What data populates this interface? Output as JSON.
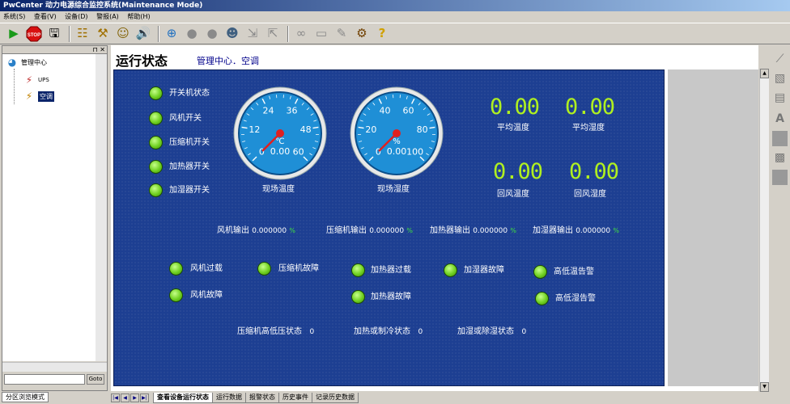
{
  "window": {
    "title": "PwCenter 动力电源综合监控系统(Maintenance Mode)"
  },
  "menu": [
    "系统(S)",
    "查看(V)",
    "设备(D)",
    "警报(A)",
    "帮助(H)"
  ],
  "toolbar": {
    "stop_label": "STOP"
  },
  "tree": {
    "root": "管理中心",
    "children": [
      "UPS",
      "空调"
    ],
    "selected": "空调"
  },
  "goto": {
    "label": "Goto"
  },
  "mode_tab": {
    "label": "分区浏览模式"
  },
  "page": {
    "title": "运行状态",
    "subtitle": "管理中心．空调"
  },
  "status_lamps": [
    {
      "label": "开关机状态"
    },
    {
      "label": "风机开关"
    },
    {
      "label": "压缩机开关"
    },
    {
      "label": "加热器开关"
    },
    {
      "label": "加湿器开关"
    }
  ],
  "gauges": [
    {
      "name": "现场温度",
      "unit": "℃",
      "ticks": [
        "0",
        "12",
        "24",
        "36",
        "48",
        "60"
      ],
      "value": "0.00",
      "min": 0,
      "max": 60
    },
    {
      "name": "现场湿度",
      "unit": "%",
      "ticks": [
        "0",
        "20",
        "40",
        "60",
        "80",
        "100"
      ],
      "value": "0.00",
      "min": 0,
      "max": 100
    }
  ],
  "digital_readouts": [
    {
      "value": "0.00",
      "label": "平均温度"
    },
    {
      "value": "0.00",
      "label": "平均湿度"
    },
    {
      "value": "0.00",
      "label": "回风温度"
    },
    {
      "value": "0.00",
      "label": "回风湿度"
    }
  ],
  "outputs": [
    {
      "label": "风机输出",
      "value": "0.000000",
      "unit": "%"
    },
    {
      "label": "压缩机输出",
      "value": "0.000000",
      "unit": "%"
    },
    {
      "label": "加热器输出",
      "value": "0.000000",
      "unit": "%"
    },
    {
      "label": "加湿器输出",
      "value": "0.000000",
      "unit": "%"
    }
  ],
  "alarms": [
    {
      "label": "风机过载"
    },
    {
      "label": "风机故障"
    },
    {
      "label": "压缩机故障"
    },
    {
      "label": "加热器过载"
    },
    {
      "label": "加热器故障"
    },
    {
      "label": "加湿器故障"
    },
    {
      "label": "高低温告警"
    },
    {
      "label": "高低湿告警"
    }
  ],
  "states": [
    {
      "label": "压缩机高低压状态",
      "value": "0"
    },
    {
      "label": "加热或制冷状态",
      "value": "0"
    },
    {
      "label": "加湿或除湿状态",
      "value": "0"
    }
  ],
  "bottom_tabs": [
    "查看设备运行状态",
    "运行数据",
    "报警状态",
    "历史事件",
    "记录历史数据"
  ],
  "colors": {
    "panel": "#1d3f92",
    "lamp": "#6fd020",
    "lcd": "#b0f020",
    "gauge_face": "#1f8fd6"
  }
}
